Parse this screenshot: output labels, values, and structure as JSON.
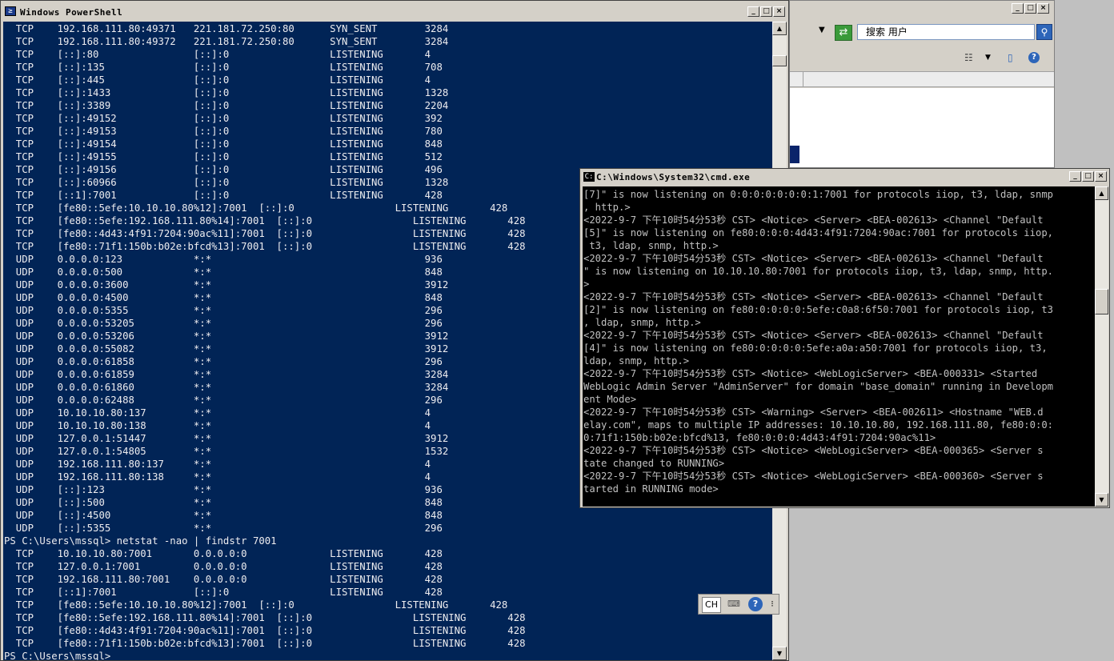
{
  "explorer": {
    "search_placeholder": "搜索 用户",
    "dropdown_glyph": "▼",
    "go_glyph": "⇄",
    "search_button_glyph": "⚲",
    "view_glyph": "☷",
    "view_dd_glyph": "▼",
    "pane_glyph": "▯",
    "help_glyph": "?"
  },
  "powershell": {
    "title": "Windows PowerShell",
    "icon_glyph": "≥",
    "lines": [
      "  TCP    192.168.111.80:49371   221.181.72.250:80      SYN_SENT        3284",
      "  TCP    192.168.111.80:49372   221.181.72.250:80      SYN_SENT        3284",
      "  TCP    [::]:80                [::]:0                 LISTENING       4",
      "  TCP    [::]:135               [::]:0                 LISTENING       708",
      "  TCP    [::]:445               [::]:0                 LISTENING       4",
      "  TCP    [::]:1433              [::]:0                 LISTENING       1328",
      "  TCP    [::]:3389              [::]:0                 LISTENING       2204",
      "  TCP    [::]:49152             [::]:0                 LISTENING       392",
      "  TCP    [::]:49153             [::]:0                 LISTENING       780",
      "  TCP    [::]:49154             [::]:0                 LISTENING       848",
      "  TCP    [::]:49155             [::]:0                 LISTENING       512",
      "  TCP    [::]:49156             [::]:0                 LISTENING       496",
      "  TCP    [::]:60966             [::]:0                 LISTENING       1328",
      "  TCP    [::1]:7001             [::]:0                 LISTENING       428",
      "  TCP    [fe80::5efe:10.10.10.80%12]:7001  [::]:0                 LISTENING       428",
      "  TCP    [fe80::5efe:192.168.111.80%14]:7001  [::]:0                 LISTENING       428",
      "  TCP    [fe80::4d43:4f91:7204:90ac%11]:7001  [::]:0                 LISTENING       428",
      "  TCP    [fe80::71f1:150b:b02e:bfcd%13]:7001  [::]:0                 LISTENING       428",
      "  UDP    0.0.0.0:123            *:*                                    936",
      "  UDP    0.0.0.0:500            *:*                                    848",
      "  UDP    0.0.0.0:3600           *:*                                    3912",
      "  UDP    0.0.0.0:4500           *:*                                    848",
      "  UDP    0.0.0.0:5355           *:*                                    296",
      "  UDP    0.0.0.0:53205          *:*                                    296",
      "  UDP    0.0.0.0:53206          *:*                                    3912",
      "  UDP    0.0.0.0:55082          *:*                                    3912",
      "  UDP    0.0.0.0:61858          *:*                                    296",
      "  UDP    0.0.0.0:61859          *:*                                    3284",
      "  UDP    0.0.0.0:61860          *:*                                    3284",
      "  UDP    0.0.0.0:62488          *:*                                    296",
      "  UDP    10.10.10.80:137        *:*                                    4",
      "  UDP    10.10.10.80:138        *:*                                    4",
      "  UDP    127.0.0.1:51447        *:*                                    3912",
      "  UDP    127.0.0.1:54805        *:*                                    1532",
      "  UDP    192.168.111.80:137     *:*                                    4",
      "  UDP    192.168.111.80:138     *:*                                    4",
      "  UDP    [::]:123               *:*                                    936",
      "  UDP    [::]:500               *:*                                    848",
      "  UDP    [::]:4500              *:*                                    848",
      "  UDP    [::]:5355              *:*                                    296",
      "PS C:\\Users\\mssql> netstat -nao | findstr 7001",
      "  TCP    10.10.10.80:7001       0.0.0.0:0              LISTENING       428",
      "  TCP    127.0.0.1:7001         0.0.0.0:0              LISTENING       428",
      "  TCP    192.168.111.80:7001    0.0.0.0:0              LISTENING       428",
      "  TCP    [::1]:7001             [::]:0                 LISTENING       428",
      "  TCP    [fe80::5efe:10.10.10.80%12]:7001  [::]:0                 LISTENING       428",
      "  TCP    [fe80::5efe:192.168.111.80%14]:7001  [::]:0                 LISTENING       428",
      "  TCP    [fe80::4d43:4f91:7204:90ac%11]:7001  [::]:0                 LISTENING       428",
      "  TCP    [fe80::71f1:150b:b02e:bfcd%13]:7001  [::]:0                 LISTENING       428",
      "PS C:\\Users\\mssql>"
    ]
  },
  "ime": {
    "lang": "CH",
    "kbd_glyph": "⌨",
    "help_glyph": "?",
    "more_glyph": "⁝"
  },
  "cmd": {
    "title": "C:\\Windows\\System32\\cmd.exe",
    "icon_glyph": "C:",
    "lines": [
      "[7]\" is now listening on 0:0:0:0:0:0:0:1:7001 for protocols iiop, t3, ldap, snmp",
      ", http.>",
      "<2022-9-7 下午10时54分53秒 CST> <Notice> <Server> <BEA-002613> <Channel \"Default",
      "[5]\" is now listening on fe80:0:0:0:4d43:4f91:7204:90ac:7001 for protocols iiop,",
      " t3, ldap, snmp, http.>",
      "<2022-9-7 下午10时54分53秒 CST> <Notice> <Server> <BEA-002613> <Channel \"Default",
      "\" is now listening on 10.10.10.80:7001 for protocols iiop, t3, ldap, snmp, http.",
      ">",
      "<2022-9-7 下午10时54分53秒 CST> <Notice> <Server> <BEA-002613> <Channel \"Default",
      "[2]\" is now listening on fe80:0:0:0:0:5efe:c0a8:6f50:7001 for protocols iiop, t3",
      ", ldap, snmp, http.>",
      "<2022-9-7 下午10时54分53秒 CST> <Notice> <Server> <BEA-002613> <Channel \"Default",
      "[4]\" is now listening on fe80:0:0:0:0:5efe:a0a:a50:7001 for protocols iiop, t3,",
      "ldap, snmp, http.>",
      "<2022-9-7 下午10时54分53秒 CST> <Notice> <WebLogicServer> <BEA-000331> <Started",
      "WebLogic Admin Server \"AdminServer\" for domain \"base_domain\" running in Developm",
      "ent Mode>",
      "<2022-9-7 下午10时54分53秒 CST> <Warning> <Server> <BEA-002611> <Hostname \"WEB.d",
      "elay.com\", maps to multiple IP addresses: 10.10.10.80, 192.168.111.80, fe80:0:0:",
      "0:71f1:150b:b02e:bfcd%13, fe80:0:0:0:4d43:4f91:7204:90ac%11>",
      "<2022-9-7 下午10时54分53秒 CST> <Notice> <WebLogicServer> <BEA-000365> <Server s",
      "tate changed to RUNNING>",
      "<2022-9-7 下午10时54分53秒 CST> <Notice> <WebLogicServer> <BEA-000360> <Server s",
      "tarted in RUNNING mode>",
      "_"
    ]
  },
  "window_buttons": {
    "minimize": "_",
    "maximize": "□",
    "close": "×"
  },
  "scroll_glyphs": {
    "up": "▲",
    "down": "▼"
  }
}
